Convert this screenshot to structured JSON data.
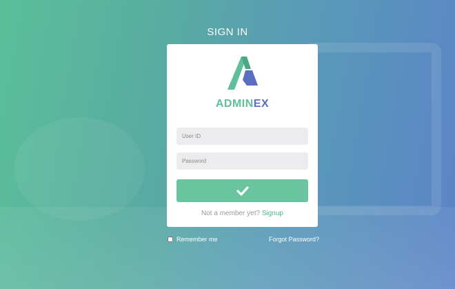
{
  "heading": "SIGN IN",
  "brand": {
    "part1": "ADMIN",
    "part2": "EX"
  },
  "form": {
    "user_placeholder": "User ID",
    "password_placeholder": "Password"
  },
  "member": {
    "text": "Not a member yet?",
    "link": "Signup"
  },
  "remember_label": "Remember me",
  "forgot_label": "Forgot Password?",
  "icons": {
    "logo": "adminex-logo",
    "submit": "checkmark-icon"
  },
  "colors": {
    "accent": "#68c5a0",
    "brand_green": "#5ebf9a",
    "brand_blue": "#5b6fc2"
  }
}
